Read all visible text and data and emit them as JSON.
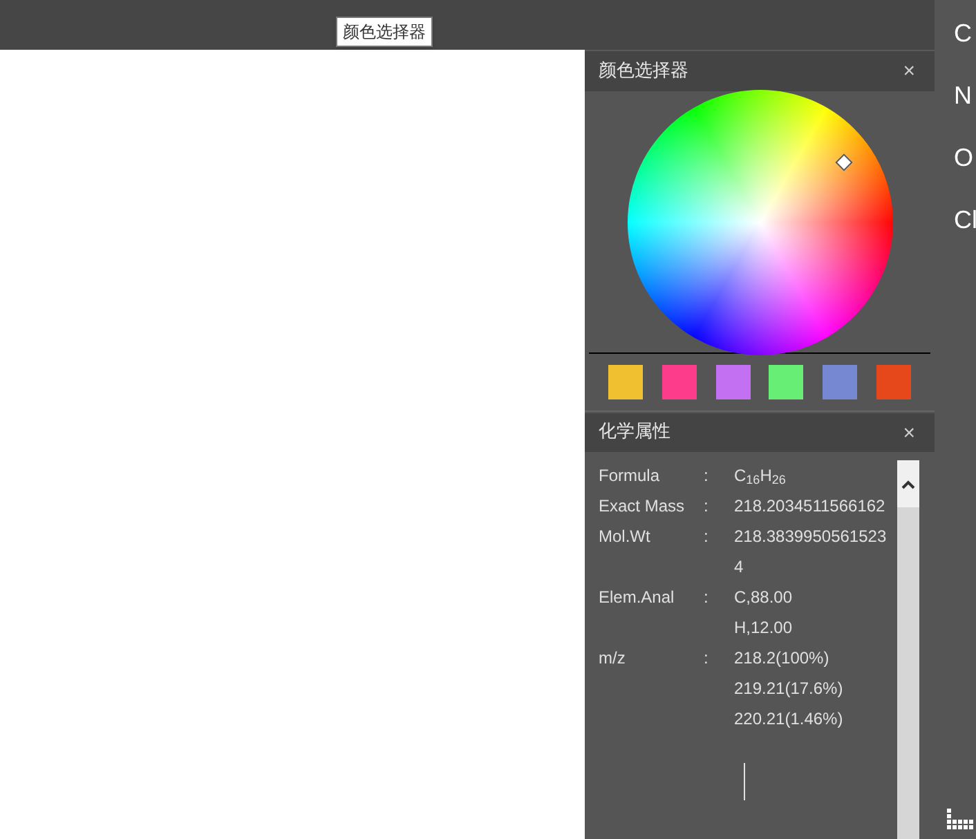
{
  "tooltip": "颜色选择器",
  "color_panel": {
    "title": "颜色选择器",
    "close": "×",
    "swatches": [
      {
        "color": "#f0c030"
      },
      {
        "color": "#fe3c8c"
      },
      {
        "color": "#c470f2"
      },
      {
        "color": "#66ef74"
      },
      {
        "color": "#7688d2"
      },
      {
        "color": "#e6481c"
      }
    ]
  },
  "properties_panel": {
    "title": "化学属性",
    "close": "×",
    "rows": [
      {
        "label": "Formula",
        "separator": ":",
        "values": [
          "C$_{16}$H$_{26}$"
        ]
      },
      {
        "label": "Exact Mass",
        "separator": ":",
        "values": [
          "218.2034511566162"
        ]
      },
      {
        "label": "Mol.Wt",
        "separator": ":",
        "values": [
          "218.3839950561523",
          "4"
        ]
      },
      {
        "label": "Elem.Anal",
        "separator": ":",
        "values": [
          "C,88.00",
          "H,12.00"
        ]
      },
      {
        "label": "m/z",
        "separator": ":",
        "values": [
          "218.2(100%)",
          "219.21(17.6%)",
          "220.21(1.46%)"
        ]
      }
    ]
  },
  "element_bar": [
    "C",
    "N",
    "O",
    "Cl"
  ]
}
